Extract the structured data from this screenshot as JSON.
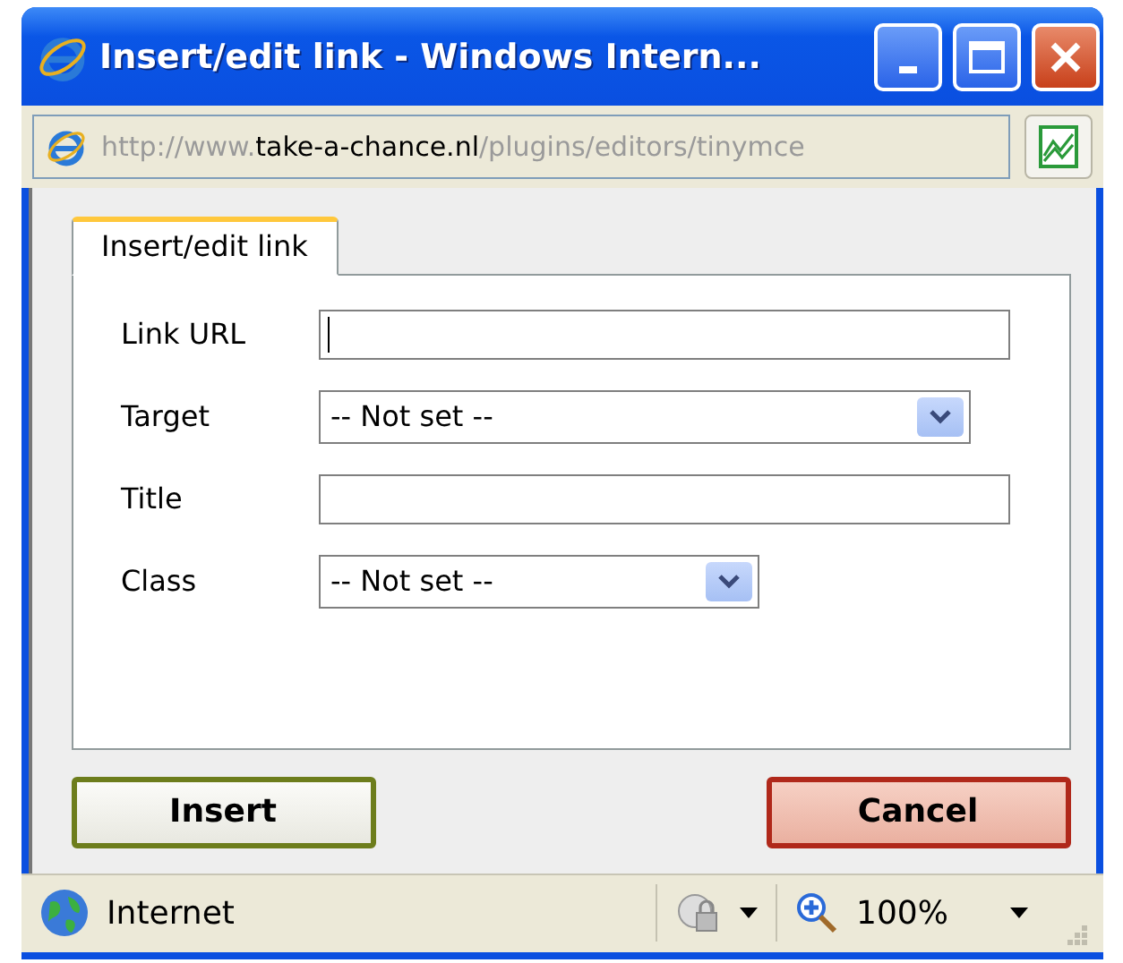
{
  "window": {
    "title": "Insert/edit link - Windows Intern..."
  },
  "address_bar": {
    "scheme": "http://www.",
    "host": "take-a-chance.nl",
    "path": "/plugins/editors/tinymce"
  },
  "tabs": [
    {
      "label": "Insert/edit link",
      "selected": true
    }
  ],
  "fields": [
    {
      "kind": "text",
      "label": "Link URL",
      "focused": true
    },
    {
      "kind": "select",
      "label": "Target",
      "value": "-- Not set --"
    },
    {
      "kind": "text",
      "label": "Title",
      "focused": false
    },
    {
      "kind": "select",
      "label": "Class",
      "value": "-- Not set --"
    }
  ],
  "buttons": [
    {
      "kind": "ok",
      "label": "Insert"
    },
    {
      "kind": "cancel",
      "label": "Cancel"
    }
  ],
  "status_bar": {
    "zone": "Internet",
    "zoom": "100%"
  }
}
